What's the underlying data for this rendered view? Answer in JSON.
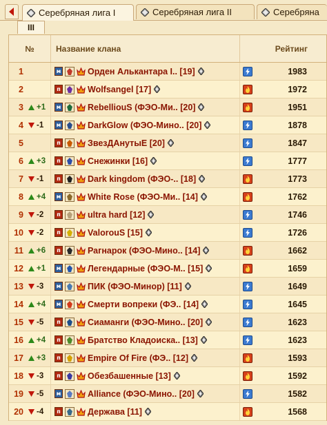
{
  "tabs": [
    {
      "label": "Серебряная лига I",
      "active": true
    },
    {
      "label": "Серебряная лига II",
      "active": false
    },
    {
      "label": "Серебряна",
      "active": false
    }
  ],
  "subtab": {
    "label": "III"
  },
  "table": {
    "headers": {
      "num": "№",
      "name": "Название клана",
      "rating": "Рейтинг"
    },
    "rows": [
      {
        "rank": "1",
        "change": "",
        "dir": "",
        "mode": "м",
        "emblem": "#c0392b",
        "name": "Орден Алькантара I..",
        "level": "[19]",
        "type": "light",
        "rating": "1983"
      },
      {
        "rank": "2",
        "change": "",
        "dir": "",
        "mode": "п",
        "emblem": "#6b2fa0",
        "name": "Wolfsangel",
        "level": "[17]",
        "type": "fire",
        "rating": "1972"
      },
      {
        "rank": "3",
        "change": "+1",
        "dir": "up",
        "mode": "м",
        "emblem": "#1d6b3a",
        "name": "RebelliouS (ФЭО-Ми..",
        "level": "[20]",
        "type": "fire",
        "rating": "1951"
      },
      {
        "rank": "4",
        "change": "-1",
        "dir": "down",
        "mode": "м",
        "emblem": "#2b4f8c",
        "name": "DarkGlow (ФЭО-Мино..",
        "level": "[20]",
        "type": "light",
        "rating": "1878"
      },
      {
        "rank": "5",
        "change": "",
        "dir": "",
        "mode": "п",
        "emblem": "#c85a00",
        "name": "ЗвезДАнутыЕ",
        "level": "[20]",
        "type": "light",
        "rating": "1847"
      },
      {
        "rank": "6",
        "change": "+3",
        "dir": "up",
        "mode": "п",
        "emblem": "#2d4ea8",
        "name": "Снежинки",
        "level": "[16]",
        "type": "light",
        "rating": "1777"
      },
      {
        "rank": "7",
        "change": "-1",
        "dir": "down",
        "mode": "п",
        "emblem": "#222222",
        "name": "Dark kingdom (ФЭО-..",
        "level": "[18]",
        "type": "fire",
        "rating": "1773"
      },
      {
        "rank": "8",
        "change": "+4",
        "dir": "up",
        "mode": "м",
        "emblem": "#8a6a2a",
        "name": "White Rose (ФЭО-Ми..",
        "level": "[14]",
        "type": "fire",
        "rating": "1762"
      },
      {
        "rank": "9",
        "change": "-2",
        "dir": "down",
        "mode": "п",
        "emblem": "#b7a07a",
        "name": "ultra hard",
        "level": "[12]",
        "type": "light",
        "rating": "1746"
      },
      {
        "rank": "10",
        "change": "-2",
        "dir": "down",
        "mode": "п",
        "emblem": "#d4b000",
        "name": "ValorouS",
        "level": "[15]",
        "type": "light",
        "rating": "1726"
      },
      {
        "rank": "11",
        "change": "+6",
        "dir": "up",
        "mode": "п",
        "emblem": "#2a2a2a",
        "name": "Рагнарок (ФЭО-Мино..",
        "level": "[14]",
        "type": "fire",
        "rating": "1662"
      },
      {
        "rank": "12",
        "change": "+1",
        "dir": "up",
        "mode": "м",
        "emblem": "#2255aa",
        "name": "Легендарные (ФЭО-М..",
        "level": "[15]",
        "type": "fire",
        "rating": "1659"
      },
      {
        "rank": "13",
        "change": "-3",
        "dir": "down",
        "mode": "м",
        "emblem": "#4a7ab0",
        "name": "ПИК (ФЭО-Минор)",
        "level": "[11]",
        "type": "light",
        "rating": "1649"
      },
      {
        "rank": "14",
        "change": "+4",
        "dir": "up",
        "mode": "м",
        "emblem": "#d23a1a",
        "name": "Смерти вопреки (ФЭ..",
        "level": "[14]",
        "type": "light",
        "rating": "1645"
      },
      {
        "rank": "15",
        "change": "-5",
        "dir": "down",
        "mode": "п",
        "emblem": "#1f4f8a",
        "name": "Сиаманги (ФЭО-Мино..",
        "level": "[20]",
        "type": "light",
        "rating": "1623"
      },
      {
        "rank": "16",
        "change": "+4",
        "dir": "up",
        "mode": "п",
        "emblem": "#4c8a2a",
        "name": "Братство Кладоиска..",
        "level": "[13]",
        "type": "light",
        "rating": "1623"
      },
      {
        "rank": "17",
        "change": "+3",
        "dir": "up",
        "mode": "п",
        "emblem": "#d4a000",
        "name": "Empire Of Fire (ФЭ..",
        "level": "[12]",
        "type": "fire",
        "rating": "1593"
      },
      {
        "rank": "18",
        "change": "-3",
        "dir": "down",
        "mode": "п",
        "emblem": "#3a3aa0",
        "name": "Обезбашенные",
        "level": "[13]",
        "type": "fire",
        "rating": "1592"
      },
      {
        "rank": "19",
        "change": "-5",
        "dir": "down",
        "mode": "м",
        "emblem": "#5a7ac0",
        "name": "Alliance (ФЭО-Мино..",
        "level": "[20]",
        "type": "light",
        "rating": "1582"
      },
      {
        "rank": "20",
        "change": "-4",
        "dir": "down",
        "mode": "п",
        "emblem": "#3a6a8a",
        "name": "Держава",
        "level": "[11]",
        "type": "fire",
        "rating": "1568"
      }
    ]
  },
  "colors": {
    "background": "#f5e9c8",
    "clan_name": "#8a1400",
    "rank": "#b03000",
    "up": "#2d6b1a",
    "light_type": "#3b7ad0",
    "fire_type": "#d6411b"
  }
}
